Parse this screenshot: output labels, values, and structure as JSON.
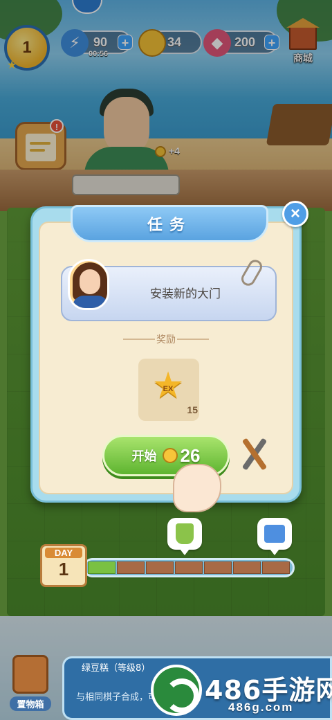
{
  "hud": {
    "level": "1",
    "energy": {
      "value": "90",
      "timer": "00:56",
      "icon": "lightning-icon"
    },
    "coins": {
      "value": "34",
      "icon": "coin-icon"
    },
    "gems": {
      "value": "200",
      "icon": "gem-icon"
    },
    "shop_label": "商城"
  },
  "scene": {
    "coin_gain": "+4"
  },
  "task_modal": {
    "title": "任务",
    "close_icon": "×",
    "task_text": "安装新的大门",
    "reward_label": "奖励",
    "reward": {
      "badge": "EX",
      "count": "15"
    },
    "start_button": {
      "label": "开始",
      "cost": "26"
    }
  },
  "day_progress": {
    "day_label": "DAY",
    "day_number": "1",
    "segments_total": 7,
    "segments_filled": 1
  },
  "bottom": {
    "storage_label": "置物箱",
    "item_title": "绿豆糕（等级8）",
    "item_desc": "与相同棋子合成，可"
  },
  "watermark": {
    "brand": "486手游网",
    "url": "486g.com"
  },
  "colors": {
    "accent_blue": "#5aa3e0",
    "start_green": "#5eb430",
    "panel_cream": "#f7ecd2"
  }
}
